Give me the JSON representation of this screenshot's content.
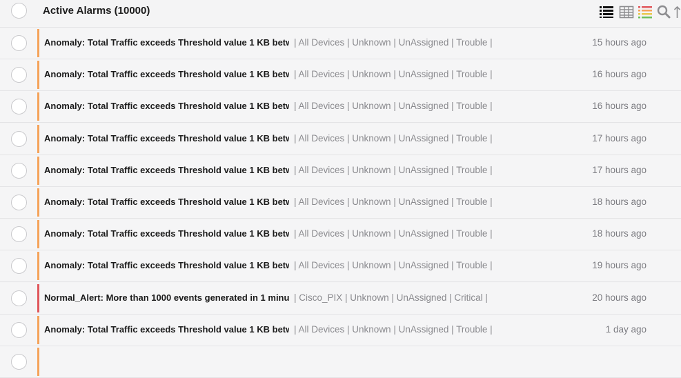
{
  "header": {
    "title": "Active Alarms (10000)"
  },
  "toolbar": {
    "icons": [
      "list-view-icon",
      "grid-view-icon",
      "severity-list-icon",
      "search-icon",
      "sort-arrow-icon"
    ]
  },
  "colors": {
    "trouble": "#f5a35a",
    "critical": "#e0565b"
  },
  "alarms": [
    {
      "title": "Anomaly: Total Traffic exceeds Threshold value 1 KB betw...",
      "meta": "| All Devices | Unknown | UnAssigned | Trouble |",
      "time": "15 hours ago",
      "severity": "trouble"
    },
    {
      "title": "Anomaly: Total Traffic exceeds Threshold value 1 KB betw...",
      "meta": "| All Devices | Unknown | UnAssigned | Trouble |",
      "time": "16 hours ago",
      "severity": "trouble"
    },
    {
      "title": "Anomaly: Total Traffic exceeds Threshold value 1 KB betw...",
      "meta": "| All Devices | Unknown | UnAssigned | Trouble |",
      "time": "16 hours ago",
      "severity": "trouble"
    },
    {
      "title": "Anomaly: Total Traffic exceeds Threshold value 1 KB betw...",
      "meta": "| All Devices | Unknown | UnAssigned | Trouble |",
      "time": "17 hours ago",
      "severity": "trouble"
    },
    {
      "title": "Anomaly: Total Traffic exceeds Threshold value 1 KB betw...",
      "meta": "| All Devices | Unknown | UnAssigned | Trouble |",
      "time": "17 hours ago",
      "severity": "trouble"
    },
    {
      "title": "Anomaly: Total Traffic exceeds Threshold value 1 KB betw...",
      "meta": "| All Devices | Unknown | UnAssigned | Trouble |",
      "time": "18 hours ago",
      "severity": "trouble"
    },
    {
      "title": "Anomaly: Total Traffic exceeds Threshold value 1 KB betw...",
      "meta": "| All Devices | Unknown | UnAssigned | Trouble |",
      "time": "18 hours ago",
      "severity": "trouble"
    },
    {
      "title": "Anomaly: Total Traffic exceeds Threshold value 1 KB betw...",
      "meta": "| All Devices | Unknown | UnAssigned | Trouble |",
      "time": "19 hours ago",
      "severity": "trouble"
    },
    {
      "title": "Normal_Alert: More than 1000 events generated in 1 minu...",
      "meta": "| Cisco_PIX | Unknown | UnAssigned | Critical |",
      "time": "20 hours ago",
      "severity": "critical"
    },
    {
      "title": "Anomaly: Total Traffic exceeds Threshold value 1 KB betw...",
      "meta": "| All Devices | Unknown | UnAssigned | Trouble |",
      "time": "1 day ago",
      "severity": "trouble"
    },
    {
      "title": "",
      "meta": "",
      "time": "",
      "severity": "trouble"
    }
  ]
}
